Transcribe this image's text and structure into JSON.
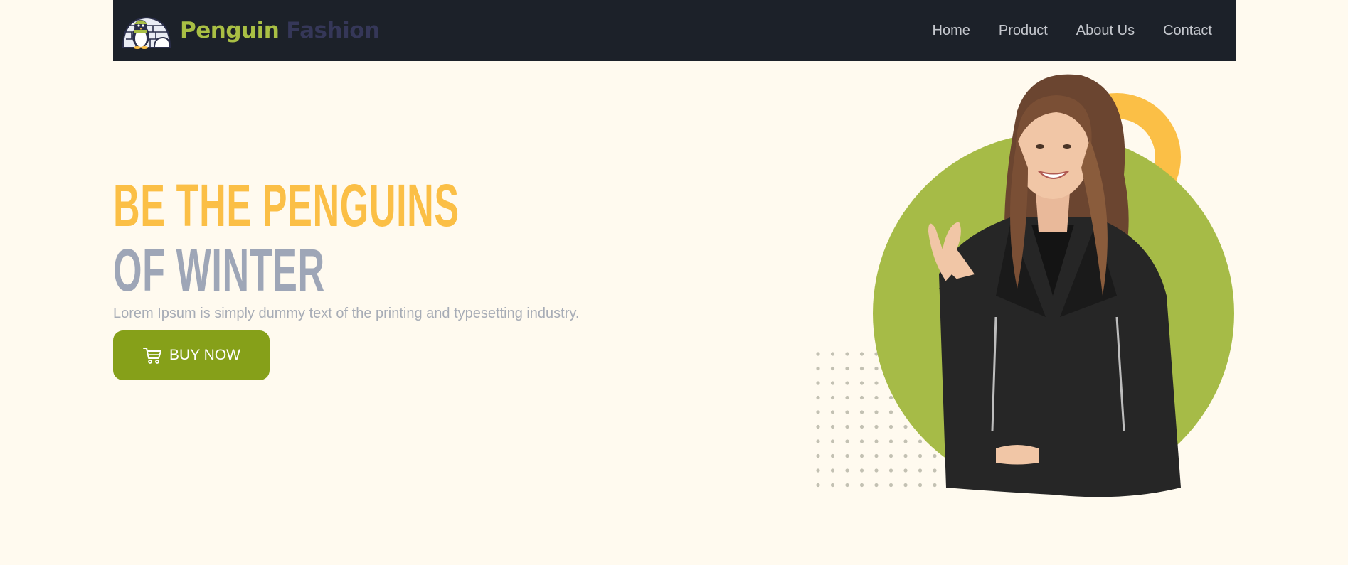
{
  "brand": {
    "name_part_1": "Penguin",
    "name_part_2": "Fashion",
    "logo_icon": "penguin-igloo-logo"
  },
  "nav": {
    "items": [
      {
        "label": "Home"
      },
      {
        "label": "Product"
      },
      {
        "label": "About Us"
      },
      {
        "label": "Contact"
      }
    ]
  },
  "hero": {
    "title_line_1": "BE THE PENGUINS",
    "title_line_2": "OF WINTER",
    "subtitle": "Lorem Ipsum is simply dummy text of the printing and typesetting industry.",
    "cta_label": "BUY NOW",
    "cta_icon": "shopping-cart-icon",
    "image_subject": "smiling woman in black leather jacket"
  },
  "colors": {
    "background": "#fffaef",
    "navbar": "#1c2129",
    "brand_green": "#a9bf44",
    "brand_navy": "#353758",
    "accent_yellow": "#fbbf46",
    "title_gray": "#9ea6b7",
    "button_green": "#86a019",
    "circle_green": "#a6bb47"
  }
}
